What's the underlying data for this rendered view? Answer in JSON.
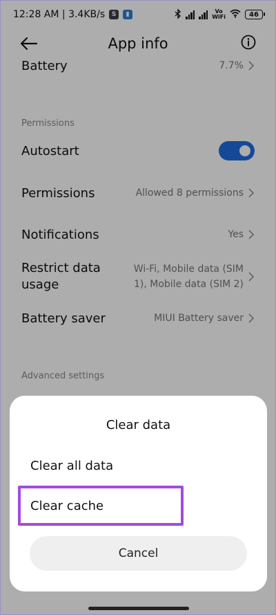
{
  "status_bar": {
    "time_speed": "12:28 AM | 3.4KB/s",
    "volte": [
      "Vo",
      "WiFi"
    ],
    "battery": "46"
  },
  "header": {
    "title": "App info"
  },
  "rows": {
    "battery": {
      "label": "Battery",
      "value": "7.7%"
    },
    "autostart": {
      "label": "Autostart",
      "enabled": true
    },
    "permissions": {
      "label": "Permissions",
      "value": "Allowed 8 permissions"
    },
    "notifications": {
      "label": "Notifications",
      "value": "Yes"
    },
    "restrict_data": {
      "label_line1": "Restrict data",
      "label_line2": "usage",
      "value_line1": "Wi-Fi, Mobile data (SIM",
      "value_line2": "1), Mobile data (SIM 2)"
    },
    "battery_saver": {
      "label": "Battery saver",
      "value": "MIUI Battery saver"
    }
  },
  "sections": {
    "permissions": "Permissions",
    "advanced": "Advanced settings"
  },
  "dialog": {
    "title": "Clear data",
    "option_all": "Clear all data",
    "option_cache": "Clear cache",
    "cancel": "Cancel"
  },
  "colors": {
    "toggle_on": "#1f6ce0",
    "highlight": "#a24be0",
    "notif_icon_1": "#3a3f4b",
    "notif_icon_2": "#2f7fd6"
  }
}
